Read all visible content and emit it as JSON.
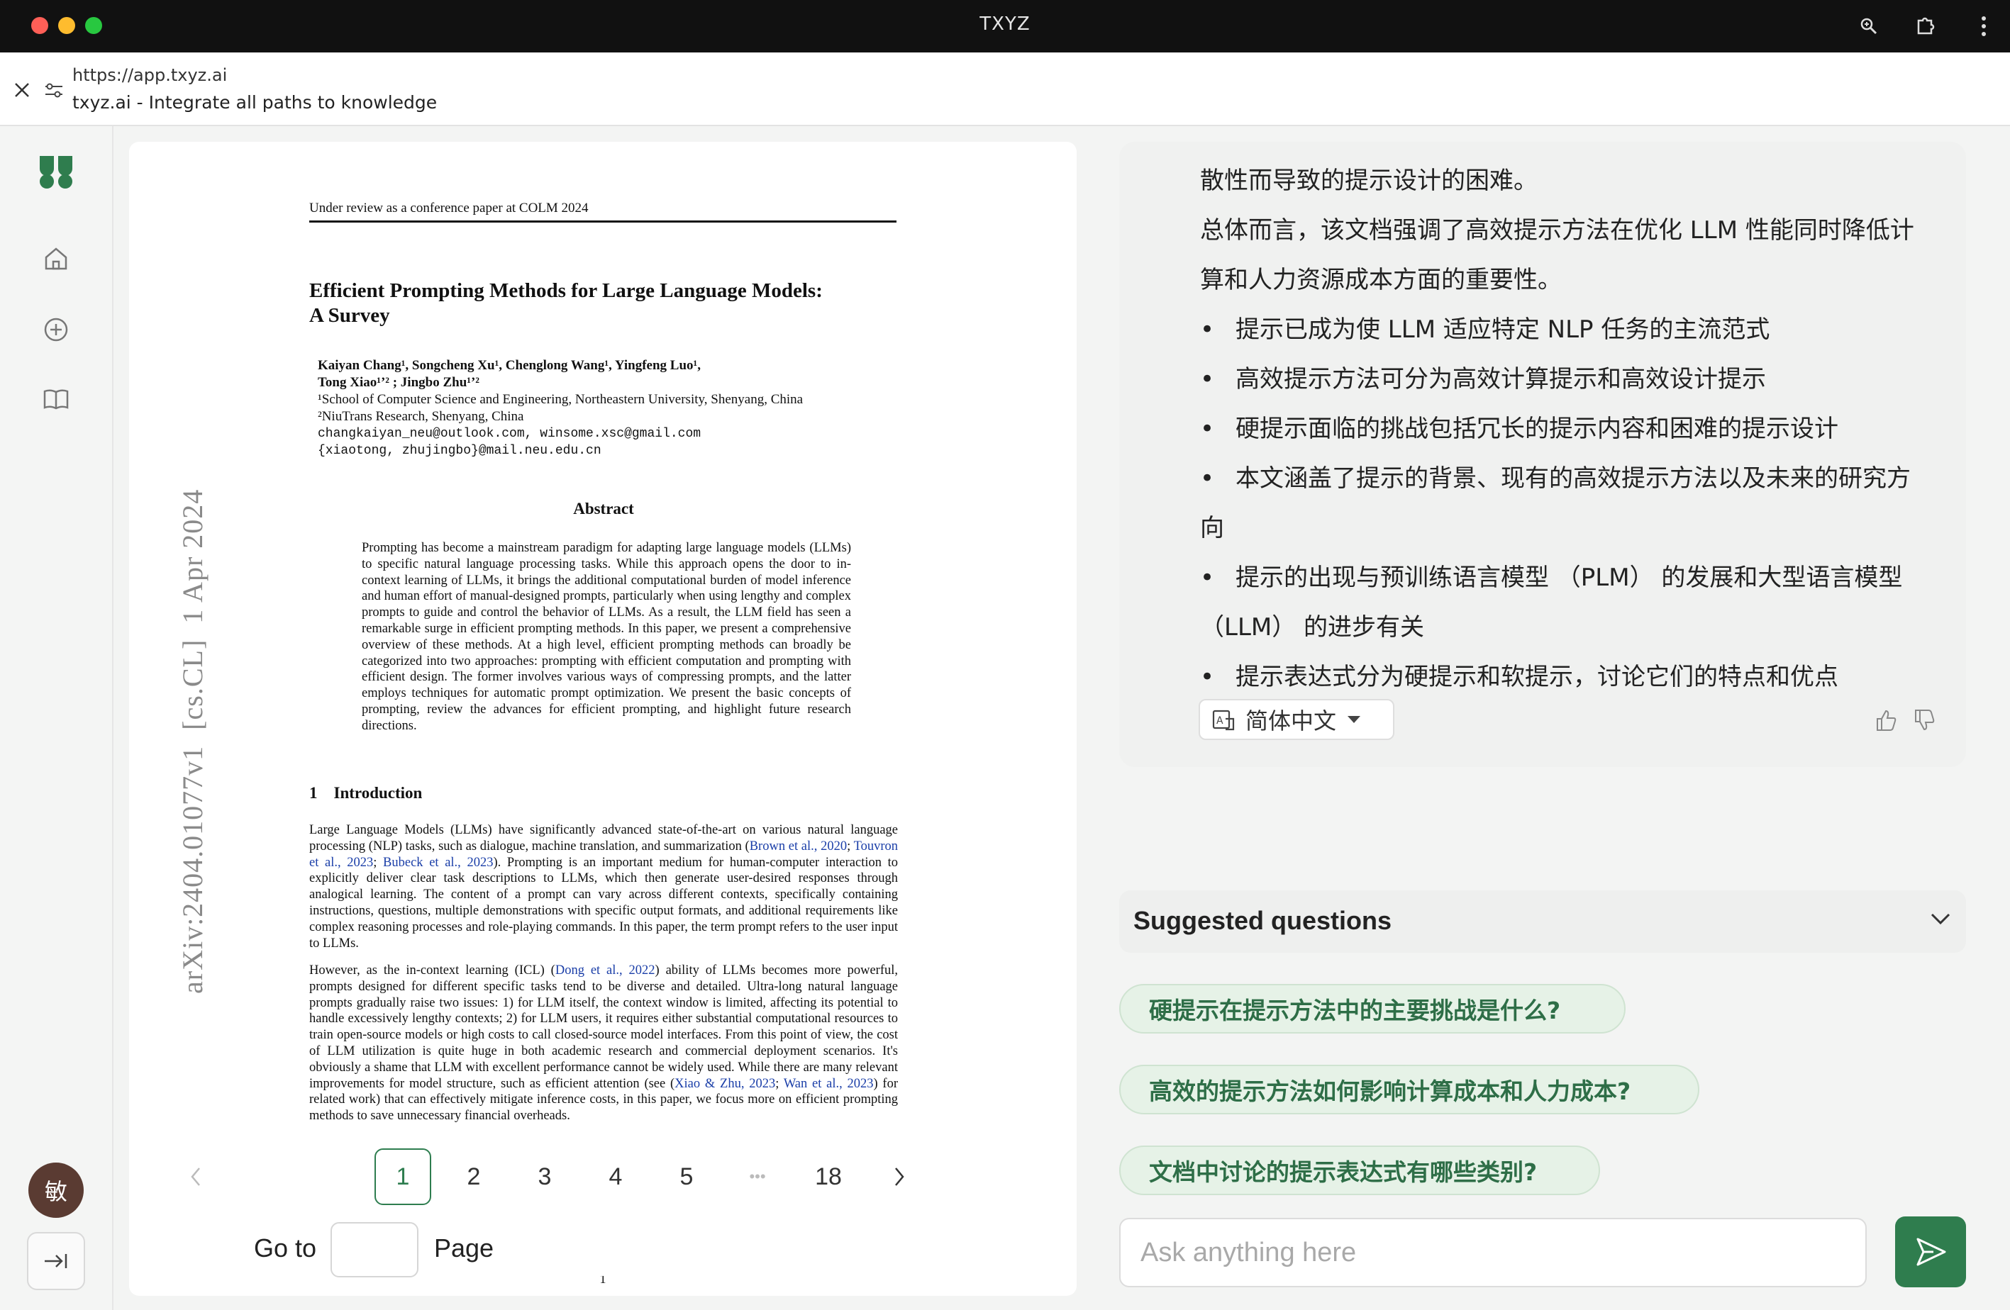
{
  "window": {
    "title": "TXYZ"
  },
  "urlbar": {
    "url": "https://app.txyz.ai",
    "page_title": "txyz.ai - Integrate all paths to knowledge"
  },
  "sidebar": {
    "avatar_text": "敏"
  },
  "pdf": {
    "header": "Under review as a conference paper at COLM 2024",
    "title_line1": "Efficient Prompting Methods for Large Language Models:",
    "title_line2": "A Survey",
    "authors_line1": "Kaiyan Chang¹, Songcheng Xu¹, Chenglong Wang¹, Yingfeng Luo¹,",
    "authors_line2": "Tong Xiao¹ʼ² ; Jingbo Zhu¹ʼ²",
    "affil1": "¹School of Computer Science and Engineering, Northeastern University, Shenyang, China",
    "affil2": "²NiuTrans Research, Shenyang, China",
    "email1": "changkaiyan_neu@outlook.com, winsome.xsc@gmail.com",
    "email2": "{xiaotong, zhujingbo}@mail.neu.edu.cn",
    "abstract_title": "Abstract",
    "abstract_body": "Prompting has become a mainstream paradigm for adapting large language models (LLMs) to specific natural language processing tasks. While this approach opens the door to in-context learning of LLMs, it brings the additional computational burden of model inference and human effort of manual-designed prompts, particularly when using lengthy and complex prompts to guide and control the behavior of LLMs. As a result, the LLM field has seen a remarkable surge in efficient prompting methods. In this paper, we present a comprehensive overview of these methods. At a high level, efficient prompting methods can broadly be categorized into two approaches: prompting with efficient computation and prompting with efficient design. The former involves various ways of compressing prompts, and the latter employs techniques for automatic prompt optimization. We present the basic concepts of prompting, review the advances for efficient prompting, and highlight future research directions.",
    "section1": "1    Introduction",
    "intro_p1_a": "Large Language Models (LLMs) have significantly advanced state-of-the-art on various natural language processing (NLP) tasks, such as dialogue, machine translation, and summarization (",
    "intro_p1_cite1": "Brown et al., 2020",
    "intro_p1_sep1": "; ",
    "intro_p1_cite2": "Touvron et al., 2023",
    "intro_p1_sep2": "; ",
    "intro_p1_cite3": "Bubeck et al., 2023",
    "intro_p1_b": "). Prompting is an important medium for human-computer interaction to explicitly deliver clear task descriptions to LLMs, which then generate user-desired responses through analogical learning. The content of a prompt can vary across different contexts, specifically containing instructions, questions, multiple demonstrations with specific output formats, and additional requirements like complex reasoning processes and role-playing commands. In this paper, the term prompt refers to the user input to LLMs.",
    "intro_p2_a": "However, as the in-context learning (ICL) (",
    "intro_p2_cite1": "Dong et al., 2022",
    "intro_p2_b": ") ability of LLMs becomes more powerful, prompts designed for different specific tasks tend to be diverse and detailed. Ultra-long natural language prompts gradually raise two issues: 1) for LLM itself, the context window is limited, affecting its potential to handle excessively lengthy contexts; 2) for LLM users, it requires either substantial computational resources to train open-source models or high costs to call closed-source model interfaces. From this point of view, the cost of LLM utilization is quite huge in both academic research and commercial deployment scenarios. It's obviously a shame that LLM with excellent performance cannot be widely used. While there are many relevant improvements for model structure, such as efficient attention (see (",
    "intro_p2_cite2": "Xiao & Zhu, 2023",
    "intro_p2_sep": "; ",
    "intro_p2_cite3": "Wan et al., 2023",
    "intro_p2_c": ") for related work) that can effectively mitigate inference costs, in this paper, we focus more on efficient prompting methods to save unnecessary financial overheads.",
    "arxiv_stamp": "arXiv:2404.01077v1  [cs.CL]  1 Apr 2024",
    "page_number": "1"
  },
  "pagination": {
    "prev": "<",
    "pages": [
      "1",
      "2",
      "3",
      "4",
      "5"
    ],
    "ellipsis": "•••",
    "last": "18",
    "next": ">",
    "goto_label": "Go to",
    "page_label": "Page",
    "current": 1
  },
  "chat": {
    "line_partial": "散性而导致的提示设计的困难。",
    "summary_line1": "总体而言，该文档强调了高效提示方法在优化 LLM 性能同时降低计",
    "summary_line2": "算和人力资源成本方面的重要性。",
    "bullets": [
      "提示已成为使 LLM 适应特定 NLP 任务的主流范式",
      "高效提示方法可分为高效计算提示和高效设计提示",
      "硬提示面临的挑战包括冗长的提示内容和困难的提示设计",
      "本文涵盖了提示的背景、现有的高效提示方法以及未来的研究方",
      "提示的出现与预训练语言模型 （PLM） 的发展和大型语言模型",
      "提示表达式分为硬提示和软提示，讨论它们的特点和优点"
    ],
    "bullet4_cont": "向",
    "bullet5_cont": "（LLM） 的进步有关",
    "language": "简体中文"
  },
  "suggestions": {
    "header": "Suggested questions",
    "items": [
      "硬提示在提示方法中的主要挑战是什么?",
      "高效的提示方法如何影响计算成本和人力成本?",
      "文档中讨论的提示表达式有哪些类别?"
    ]
  },
  "ask": {
    "placeholder": "Ask anything here"
  },
  "colors": {
    "accent": "#2f7d4e",
    "chip_bg": "#e6f2e7",
    "titlebar": "#111111"
  }
}
